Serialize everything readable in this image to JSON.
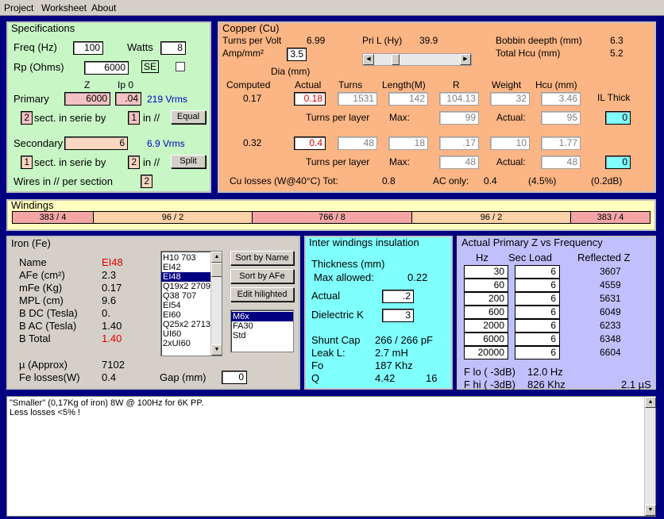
{
  "menu": [
    "Project",
    "Worksheet",
    "About"
  ],
  "specs": {
    "title": "Specifications",
    "freq_label": "Freq (Hz)",
    "freq": "100",
    "watts_label": "Watts",
    "watts": "8",
    "rp_label": "Rp (Ohms)",
    "rp": "6000",
    "se_label": "SE",
    "z_label": "Z",
    "ip0_label": "Ip 0",
    "primary_label": "Primary",
    "primary_z": "6000",
    "primary_ip0": ".04",
    "primary_vrms": "219 Vrms",
    "p_sect": "2",
    "sect_label": "sect. in serie by",
    "p_par": "1",
    "in_label": "in //",
    "equal_btn": "Equal",
    "secondary_label": "Secondary",
    "secondary_z": "6",
    "secondary_vrms": "6.9 Vrms",
    "s_sect": "1",
    "s_par": "2",
    "split_btn": "Split",
    "wires_label": "Wires in // per section",
    "wires": "2"
  },
  "copper": {
    "title": "Copper (Cu)",
    "tpv_label": "Turns per Volt",
    "tpv": "6.99",
    "pril_label": "Pri L (Hy)",
    "pril": "39.9",
    "bobbin_label": "Bobbin deepth (mm)",
    "bobbin": "6.3",
    "amp_label": "Amp/mm²",
    "amp": "3.5",
    "hcu_label": "Total Hcu (mm)",
    "hcu": "5.2",
    "slider_fraction": 0.22,
    "dia_label": "Dia (mm)",
    "headers": [
      "Computed",
      "Actual",
      "Turns",
      "Length(M)",
      "R",
      "Weight",
      "Hcu (mm)",
      "IL Thick"
    ],
    "row1": {
      "computed": "0.17",
      "actual": "0.18",
      "turns": "1531",
      "length": "142",
      "r": "104.13",
      "weight": "32",
      "hcu": "3.46"
    },
    "tpl_label": "Turns per layer",
    "max_label": "Max:",
    "act_label": "Actual:",
    "row1_tpl": {
      "max": "99",
      "actual": "95",
      "il": "0"
    },
    "row2": {
      "computed": "0.32",
      "actual": "0.4",
      "turns": "48",
      "length": "18",
      "r": ".17",
      "weight": "10",
      "hcu": "1.77"
    },
    "row2_tpl": {
      "max": "48",
      "actual": "48",
      "il": "0"
    },
    "losses_label": "Cu losses (W@40°C) Tot:",
    "losses_tot": "0.8",
    "ac_label": "AC only:",
    "ac": "0.4",
    "pct": "(4.5%)",
    "db": "(0.2dB)"
  },
  "windings": {
    "title": "Windings",
    "cells": [
      "383 / 4",
      "96 / 2",
      "766 / 8",
      "96 / 2",
      "383 / 4"
    ]
  },
  "iron": {
    "title": "Iron (Fe)",
    "name_label": "Name",
    "name": "EI48",
    "afe_label": "AFe (cm²)",
    "afe": "2.3",
    "mfe_label": "mFe (Kg)",
    "mfe": "0.17",
    "mpl_label": "MPL (cm)",
    "mpl": "9.6",
    "bdc_label": "B DC (Tesla)",
    "bdc": "0.",
    "bac_label": "B AC (Tesla)",
    "bac": "1.40",
    "btot_label": "B Total",
    "btot": "1.40",
    "mu_label": "µ (Approx)",
    "mu": "7102",
    "fel_label": "Fe losses(W)",
    "fel": "0.4",
    "gap_label": "Gap (mm)",
    "gap": "0",
    "cores": [
      "H10  703",
      "EI42",
      "EI48",
      "Q19x2  2709",
      "Q38  707",
      "EI54",
      "EI60",
      "Q25x2  2713",
      "UI60",
      "2xUI60"
    ],
    "sort_name_btn": "Sort by Name",
    "sort_afe_btn": "Sort by AFe",
    "edit_btn": "Edit hilighted",
    "materials": [
      "M6x",
      "FA30",
      "Std"
    ]
  },
  "insulation": {
    "title": "Inter windings insulation",
    "thick_label": "Thickness (mm)",
    "max_label": "Max allowed:",
    "max": "0.22",
    "actual_label": "Actual",
    "actual": ".2",
    "dk_label": "Dielectric K",
    "dk": "3",
    "shunt_label": "Shunt Cap",
    "shunt": "266 / 266 pF",
    "leak_label": "Leak L:",
    "leak": "2.7 mH",
    "fo_label": "Fo",
    "fo": "187 Khz",
    "q_label": "Q",
    "q": "4.42",
    "q2": "16"
  },
  "freqresp": {
    "title": "Actual Primary Z vs Frequency",
    "hz_label": "Hz",
    "load_label": "Sec Load",
    "refl_label": "Reflected Z",
    "rows": [
      {
        "hz": "30",
        "load": "6",
        "z": "3607"
      },
      {
        "hz": "60",
        "load": "6",
        "z": "4559"
      },
      {
        "hz": "200",
        "load": "6",
        "z": "5631"
      },
      {
        "hz": "600",
        "load": "6",
        "z": "6049"
      },
      {
        "hz": "2000",
        "load": "6",
        "z": "6233"
      },
      {
        "hz": "6000",
        "load": "6",
        "z": "6348"
      },
      {
        "hz": "20000",
        "load": "6",
        "z": "6604"
      }
    ],
    "flo_label": "F lo ( -3dB)",
    "flo": "12.0 Hz",
    "fhi_label": "F hi ( -3dB)",
    "fhi": "826 Khz",
    "rise": "2.1 µS"
  },
  "notes": {
    "line1": "\"Smaller\" (0,17Kg of iron) 8W @ 100Hz for 6K PP.",
    "line2": "Less losses <5% !"
  }
}
